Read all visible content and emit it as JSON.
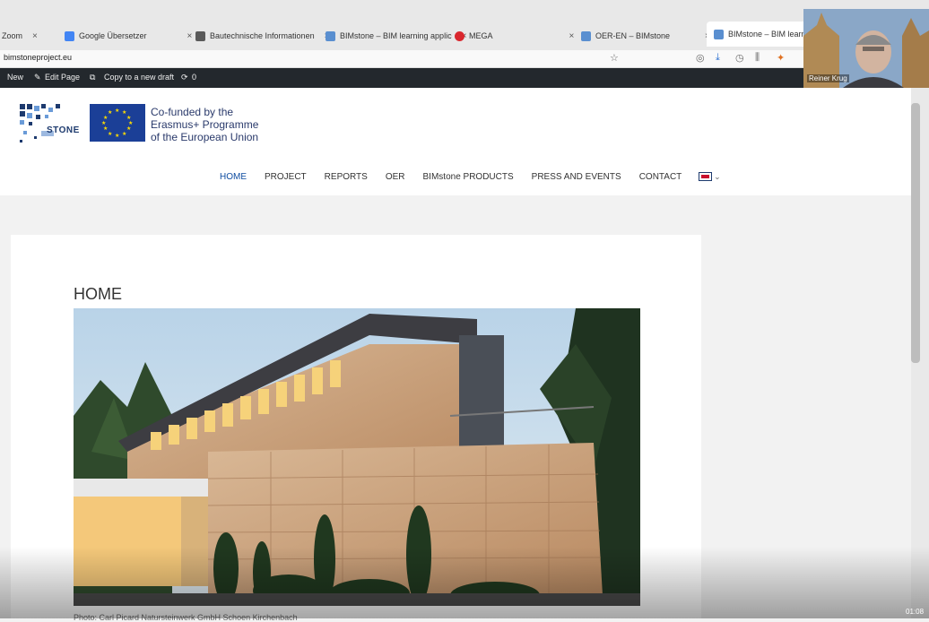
{
  "tabs": [
    {
      "label": "Zoom"
    },
    {
      "label": "Google Übersetzer"
    },
    {
      "label": "Bautechnische Informationen"
    },
    {
      "label": "BIMstone – BIM learning applic"
    },
    {
      "label": "MEGA"
    },
    {
      "label": "OER-EN – BIMstone"
    },
    {
      "label": "BIMstone – BIM learning a"
    }
  ],
  "address": {
    "url": "bimstoneproject.eu"
  },
  "wp_admin": {
    "new": "New",
    "edit_page": "Edit Page",
    "copy_draft": "Copy to a new draft",
    "count": "0"
  },
  "header": {
    "logo_text": "STONE",
    "cofund_lines": [
      "Co-funded by the",
      "Erasmus+ Programme",
      "of the European Union"
    ]
  },
  "nav": {
    "items": [
      "HOME",
      "PROJECT",
      "REPORTS",
      "OER",
      "BIMstone PRODUCTS",
      "PRESS AND EVENTS",
      "CONTACT"
    ],
    "lang_chevron": "⌄"
  },
  "content": {
    "title": "HOME",
    "caption": "Photo: Carl Picard Natursteinwerk GmbH Schoen Kirchenbach"
  },
  "webcam": {
    "name": "Reiner Krug"
  },
  "video": {
    "timecode": "01:08"
  },
  "colors": {
    "nav_active": "#0f4da1",
    "wp_bar": "#23282d",
    "eu_blue": "#1b3f97"
  }
}
